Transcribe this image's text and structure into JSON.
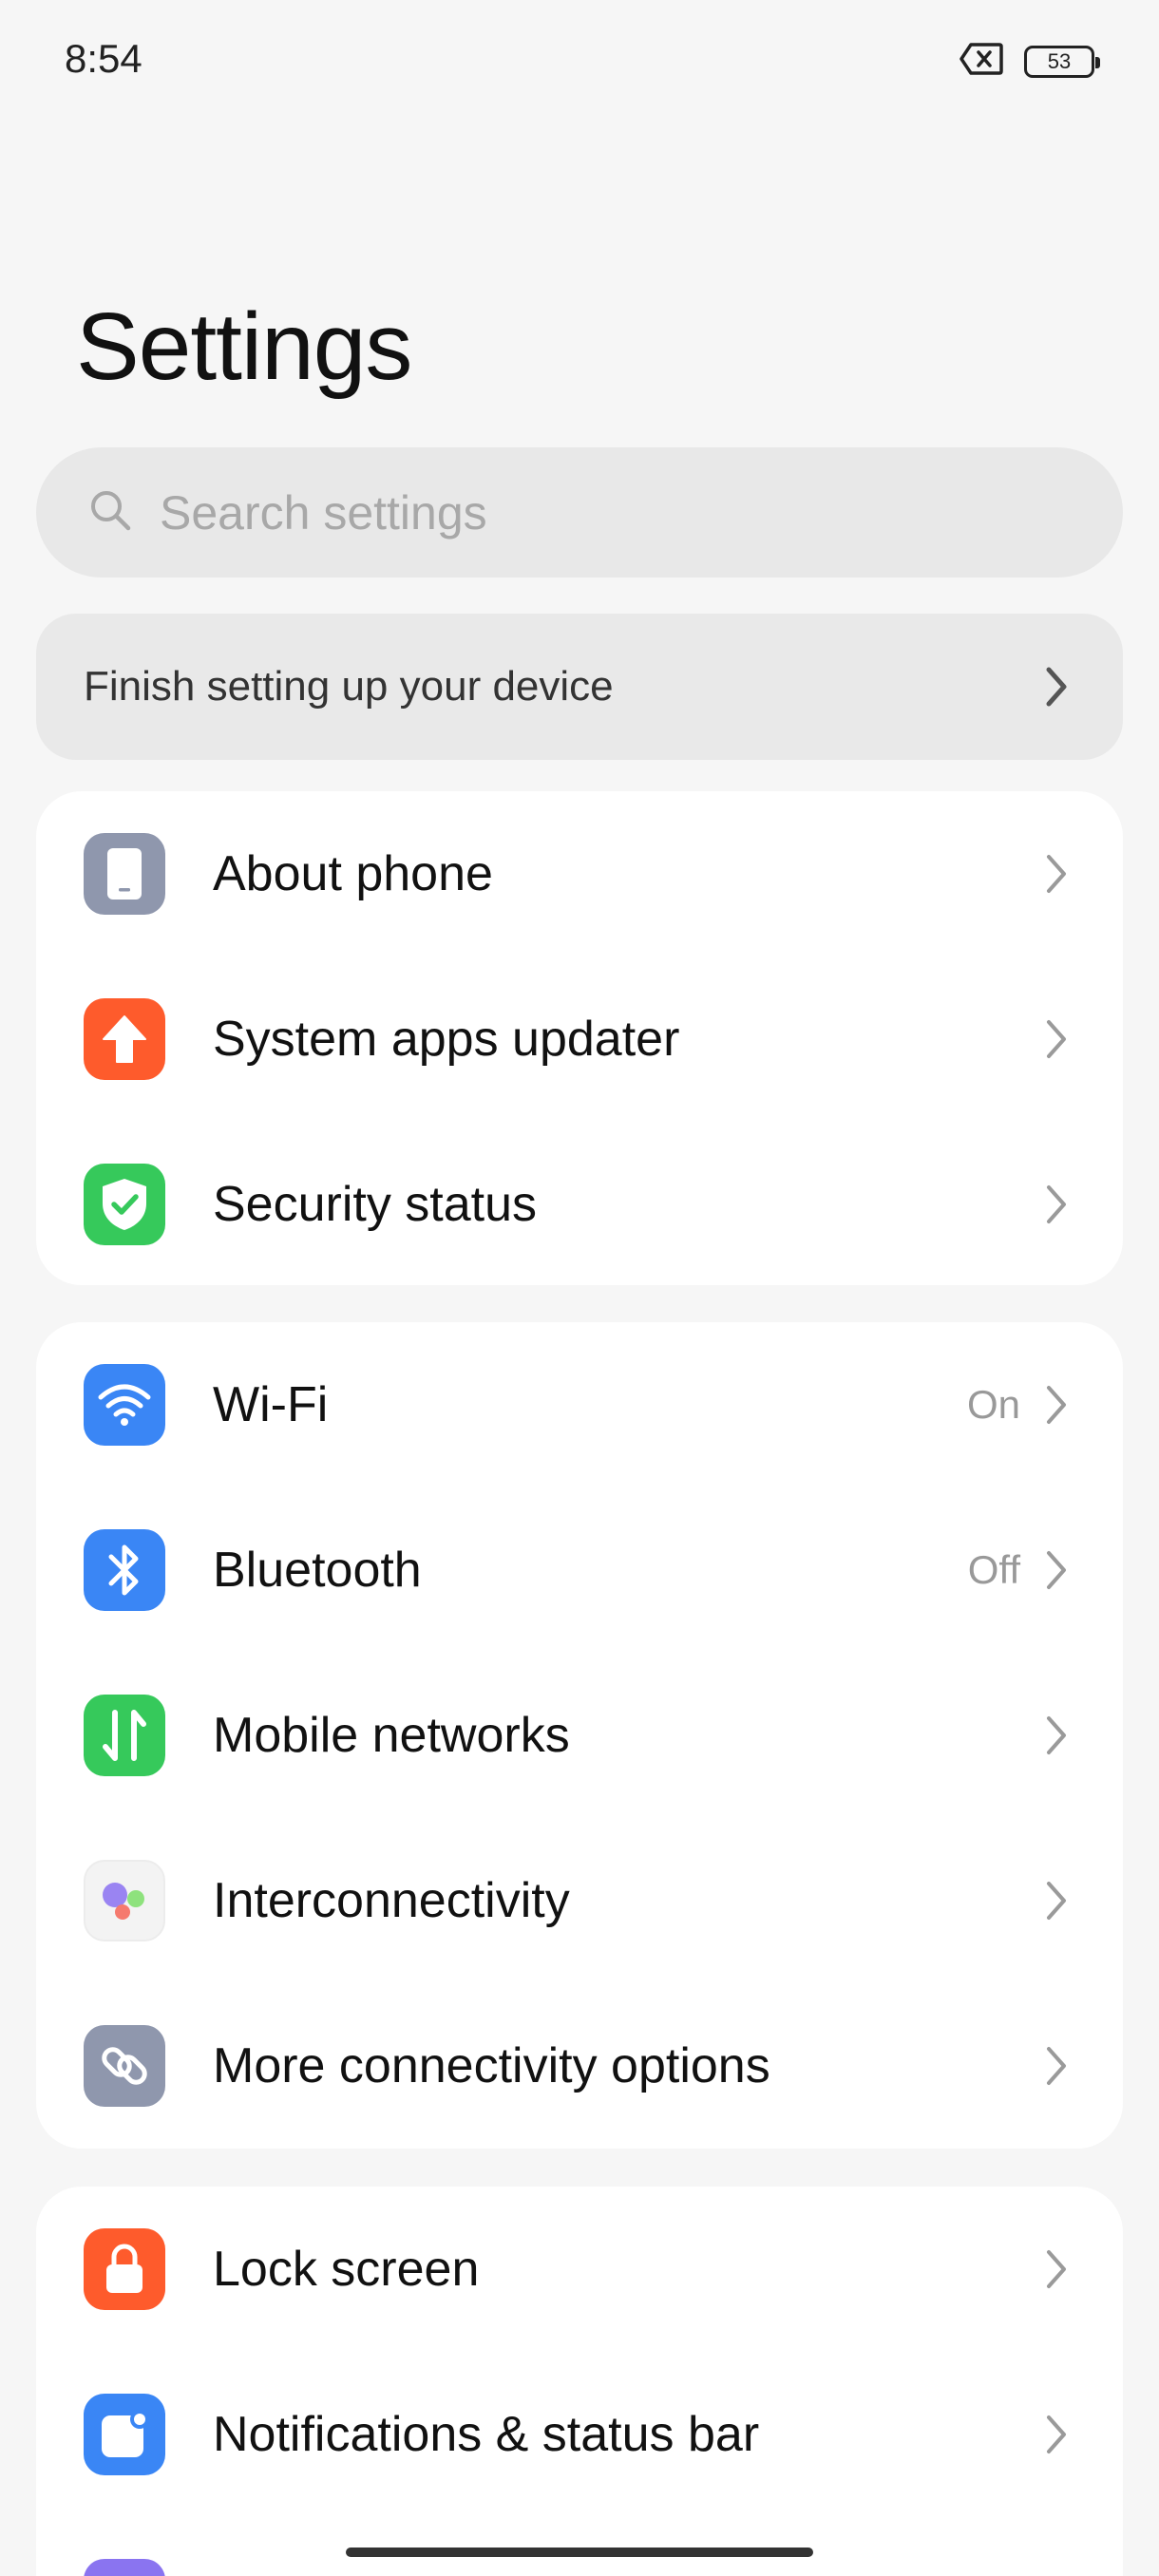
{
  "status_bar": {
    "time": "8:54",
    "battery": "53"
  },
  "title": "Settings",
  "search": {
    "placeholder": "Search settings",
    "value": ""
  },
  "setup_banner": {
    "label": "Finish setting up your device"
  },
  "group1": [
    {
      "label": "About phone",
      "icon": "phone-icon",
      "color": "#8f97ad"
    },
    {
      "label": "System apps updater",
      "icon": "arrow-up-icon",
      "color": "#fe5b2c"
    },
    {
      "label": "Security status",
      "icon": "shield-check-icon",
      "color": "#36c95b"
    }
  ],
  "group2": [
    {
      "label": "Wi-Fi",
      "value": "On",
      "icon": "wifi-icon",
      "color": "#3a86f5"
    },
    {
      "label": "Bluetooth",
      "value": "Off",
      "icon": "bluetooth-icon",
      "color": "#3a86f5"
    },
    {
      "label": "Mobile networks",
      "icon": "data-arrows-icon",
      "color": "#36c95b"
    },
    {
      "label": "Interconnectivity",
      "icon": "interconnectivity-icon",
      "color": "#f3f3f3"
    },
    {
      "label": "More connectivity options",
      "icon": "link-icon",
      "color": "#8f97ad"
    }
  ],
  "group3": [
    {
      "label": "Lock screen",
      "icon": "lock-icon",
      "color": "#fe5b2c"
    },
    {
      "label": "Notifications & status bar",
      "icon": "notification-icon",
      "color": "#3a86f5"
    }
  ]
}
